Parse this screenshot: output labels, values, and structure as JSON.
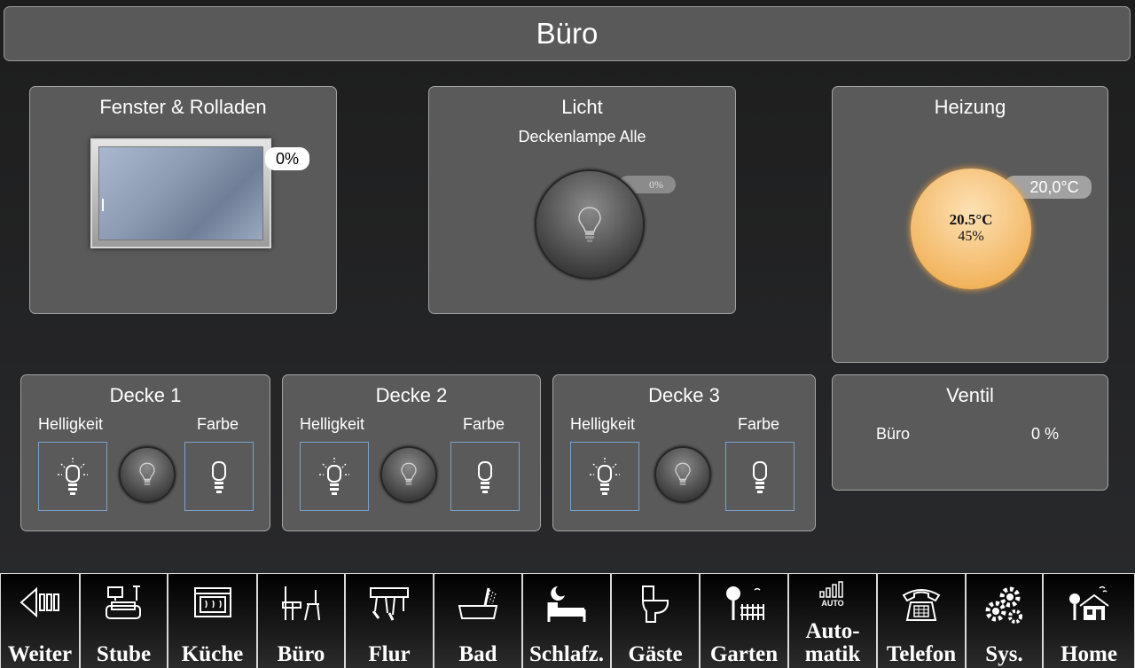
{
  "header": {
    "title": "Büro"
  },
  "window_panel": {
    "title": "Fenster & Rolladen",
    "position": "0%"
  },
  "light_panel": {
    "title": "Licht",
    "subtitle": "Deckenlampe Alle",
    "level": "0%"
  },
  "heating_panel": {
    "title": "Heizung",
    "setpoint": "20,0°C",
    "current_temp": "20.5°C",
    "humidity": "45%"
  },
  "valve_panel": {
    "title": "Ventil",
    "room": "Büro",
    "value": "0 %"
  },
  "ceiling_panels": [
    {
      "title": "Decke 1",
      "brightness_label": "Helligkeit",
      "color_label": "Farbe"
    },
    {
      "title": "Decke 2",
      "brightness_label": "Helligkeit",
      "color_label": "Farbe"
    },
    {
      "title": "Decke 3",
      "brightness_label": "Helligkeit",
      "color_label": "Farbe"
    }
  ],
  "nav": [
    {
      "label": "Weiter",
      "icon": "back-arrow-icon"
    },
    {
      "label": "Stube",
      "icon": "living-room-icon"
    },
    {
      "label": "Küche",
      "icon": "oven-icon"
    },
    {
      "label": "Büro",
      "icon": "desk-icon"
    },
    {
      "label": "Flur",
      "icon": "wardrobe-icon"
    },
    {
      "label": "Bad",
      "icon": "bathtub-icon"
    },
    {
      "label": "Schlafz.",
      "icon": "bed-icon"
    },
    {
      "label": "Gäste",
      "icon": "toilet-icon"
    },
    {
      "label": "Garten",
      "icon": "garden-icon"
    },
    {
      "label": "Auto-",
      "label2": "matik",
      "icon": "automation-icon",
      "icon_text": "AUTO"
    },
    {
      "label": "Telefon",
      "icon": "telephone-icon"
    },
    {
      "label": "Sys.",
      "icon": "gears-icon"
    },
    {
      "label": "Home",
      "icon": "house-icon"
    }
  ]
}
